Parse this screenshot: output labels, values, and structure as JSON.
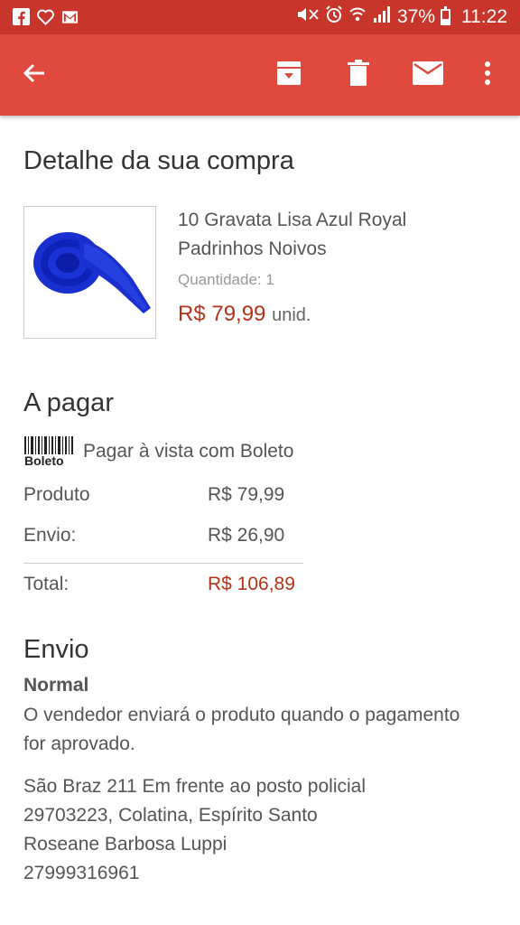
{
  "status_bar": {
    "battery_percent": "37%",
    "time": "11:22",
    "icons": [
      "facebook-icon",
      "heart-icon",
      "gmail-icon",
      "mute-icon",
      "alarm-icon",
      "wifi-icon",
      "signal-icon",
      "battery-icon"
    ],
    "battery_level": 0.37
  },
  "app_bar": {
    "icons": [
      "back-arrow-icon",
      "archive-icon",
      "delete-icon",
      "mail-icon",
      "more-vert-icon"
    ],
    "colors": {
      "app_bar": "#e04a3e",
      "status_bar": "#c8352b",
      "price": "#b33318"
    }
  },
  "purchase": {
    "heading": "Detalhe da sua compra",
    "product_title": "10 Gravata Lisa Azul Royal Padrinhos Noivos",
    "quantity_label": "Quantidade: 1",
    "price": "R$ 79,99",
    "unit": "unid."
  },
  "payment": {
    "heading": "A pagar",
    "method_label": "Pagar à vista com Boleto",
    "logo_text": "Boleto",
    "rows": [
      {
        "label": "Produto",
        "value": "R$ 79,99"
      },
      {
        "label": "Envio:",
        "value": "R$ 26,90"
      }
    ],
    "total": {
      "label": "Total:",
      "value": "R$ 106,89"
    }
  },
  "shipping": {
    "heading": "Envio",
    "type": "Normal",
    "note": "O vendedor enviará o produto quando o pagamento for aprovado.",
    "address_line1": "São Braz 211 Em frente ao posto policial",
    "address_line2": "29703223, Colatina, Espírito Santo",
    "recipient": "Roseane Barbosa Luppi",
    "phone": "27999316961"
  }
}
